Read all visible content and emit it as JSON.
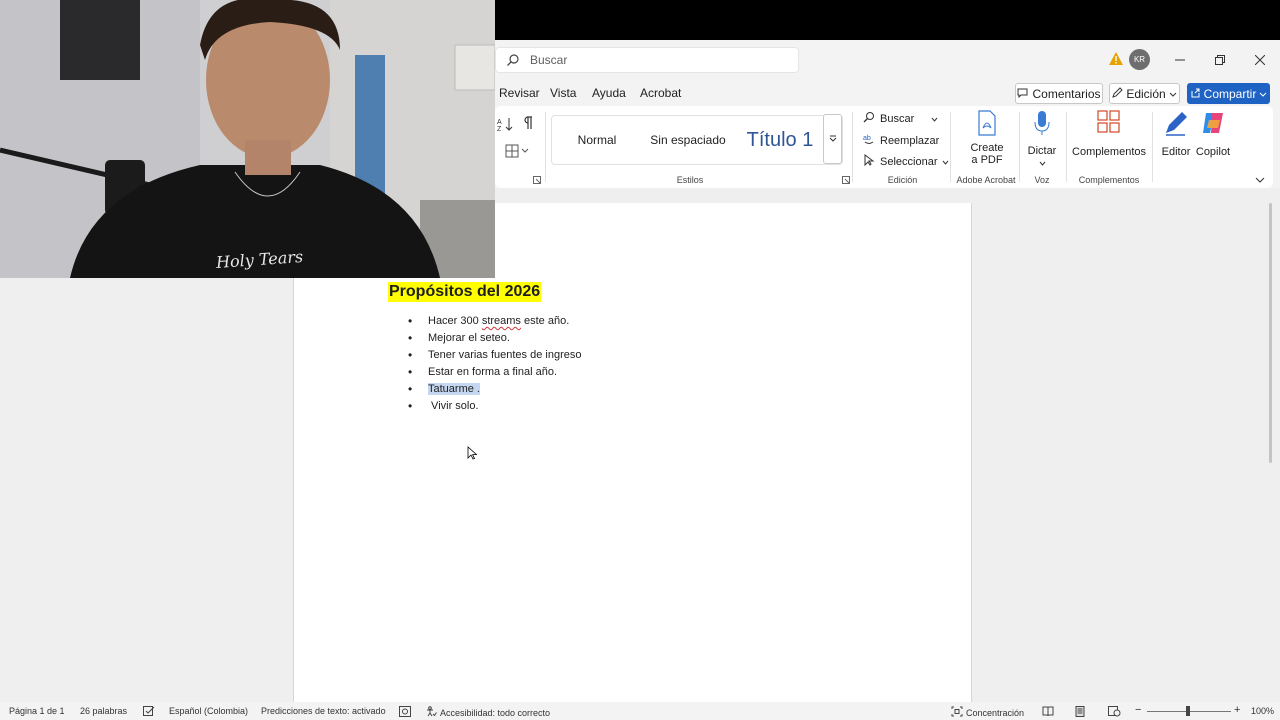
{
  "titlebar": {
    "search_placeholder": "Buscar",
    "avatar_initials": "KR"
  },
  "menubar": {
    "items": [
      "Revisar",
      "Vista",
      "Ayuda",
      "Acrobat"
    ],
    "comments_label": "Comentarios",
    "editing_label": "Edición",
    "share_label": "Compartir"
  },
  "ribbon": {
    "styles": {
      "items": [
        "Normal",
        "Sin espaciado",
        "Título 1"
      ],
      "group_label": "Estilos"
    },
    "editing": {
      "find_label": "Buscar",
      "replace_label": "Reemplazar",
      "select_label": "Seleccionar",
      "group_label": "Edición"
    },
    "acrobat": {
      "create_pdf_line1": "Create",
      "create_pdf_line2": "a PDF",
      "group_label": "Adobe Acrobat"
    },
    "voice": {
      "dictate_label": "Dictar",
      "group_label": "Voz"
    },
    "addins": {
      "addins_label": "Complementos",
      "editor_label": "Editor",
      "copilot_label": "Copilot",
      "group_label": "Complementos"
    }
  },
  "document": {
    "title": "Propósitos del 2026",
    "items": [
      {
        "before": "Hacer 300 ",
        "squiggle": "streams",
        "after": " este año."
      },
      {
        "text": "Mejorar el seteo."
      },
      {
        "text": "Tener varias fuentes de ingreso"
      },
      {
        "text": "Estar en forma a final año."
      },
      {
        "text": "Tatuarme ."
      },
      {
        "text": " Vivir solo."
      }
    ]
  },
  "webcam": {
    "shirt_text": "Holy Tears"
  },
  "statusbar": {
    "page": "Página 1 de 1",
    "words": "26 palabras",
    "language": "Español (Colombia)",
    "predictions": "Predicciones de texto: activado",
    "accessibility": "Accesibilidad: todo correcto",
    "focus": "Concentración",
    "zoom_minus": "−",
    "zoom_plus": "+",
    "zoom": "100%"
  },
  "colors": {
    "accent": "#1e63c4",
    "highlight": "#ffff00",
    "selection": "#c5d7f0",
    "spell_error": "#d13438"
  }
}
